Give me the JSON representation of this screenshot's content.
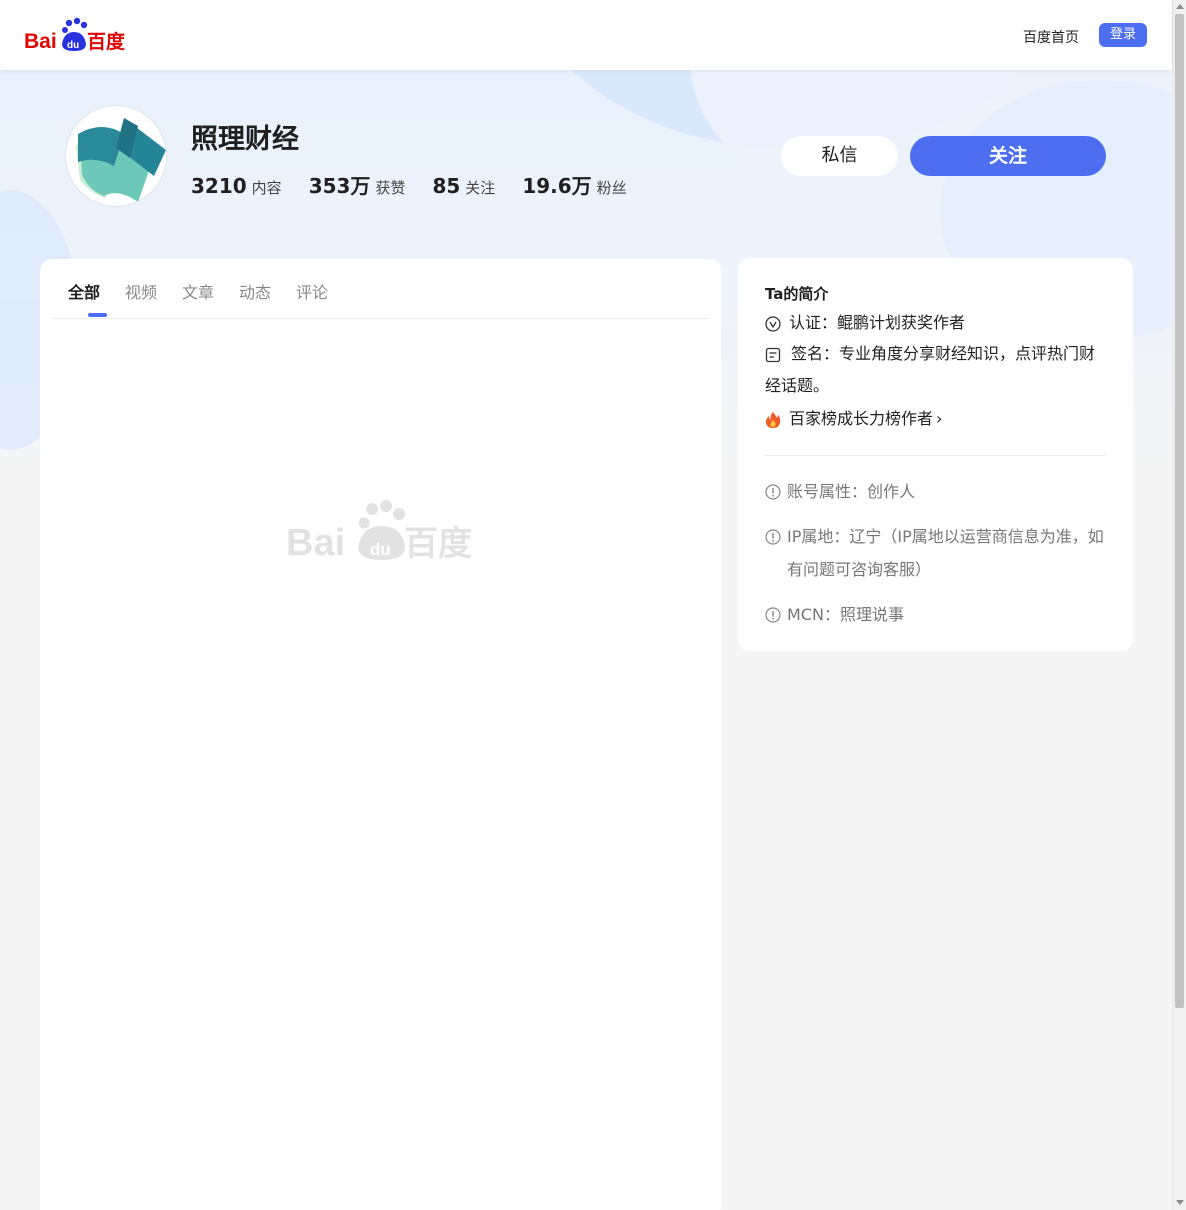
{
  "header": {
    "logo_text_bai": "Bai",
    "logo_text_du": "du",
    "logo_text_cn": "百度",
    "home_link": "百度首页",
    "login_button": "登录"
  },
  "profile": {
    "name": "照理财经",
    "stats": [
      {
        "value": "3210",
        "label": "内容"
      },
      {
        "value": "353万",
        "label": "获赞"
      },
      {
        "value": "85",
        "label": "关注"
      },
      {
        "value": "19.6万",
        "label": "粉丝"
      }
    ],
    "message_button": "私信",
    "follow_button": "关注"
  },
  "tabs": [
    "全部",
    "视频",
    "文章",
    "动态",
    "评论"
  ],
  "intro": {
    "title": "Ta的简介",
    "certification": "认证：鲲鹏计划获奖作者",
    "signature": "签名：专业角度分享财经知识，点评热门财经话题。",
    "ranking": "百家榜成长力榜作者",
    "account_type": "账号属性：创作人",
    "ip_location": "IP属地：辽宁（IP属地以运营商信息为准，如有问题可咨询客服）",
    "mcn": "MCN：照理说事"
  },
  "colors": {
    "accent": "#4e6ef2",
    "baidu_red": "#e10602",
    "baidu_blue": "#2932e1"
  },
  "icons": {
    "certification": "verified-v-icon",
    "signature": "note-icon",
    "ranking": "fire-icon",
    "info": "info-circle-icon"
  }
}
